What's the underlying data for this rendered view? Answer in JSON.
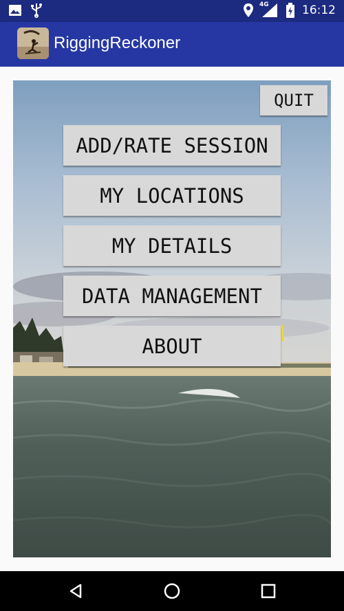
{
  "status_bar": {
    "icons_left": [
      "image-icon",
      "usb-icon"
    ],
    "network": "4G",
    "time": "16:12"
  },
  "app_bar": {
    "title": "RiggingReckoner"
  },
  "buttons": {
    "quit": "QUIT",
    "menu": [
      {
        "label": "ADD/RATE SESSION"
      },
      {
        "label": "MY LOCATIONS"
      },
      {
        "label": "MY DETAILS"
      },
      {
        "label": "DATA MANAGEMENT"
      },
      {
        "label": "ABOUT"
      }
    ]
  },
  "nav_bar": {
    "icons": [
      "back-icon",
      "home-icon",
      "recents-icon"
    ]
  },
  "colors": {
    "status_bar": "#1c2a80",
    "app_bar": "#2637a3",
    "button": "#d8d8d8"
  }
}
